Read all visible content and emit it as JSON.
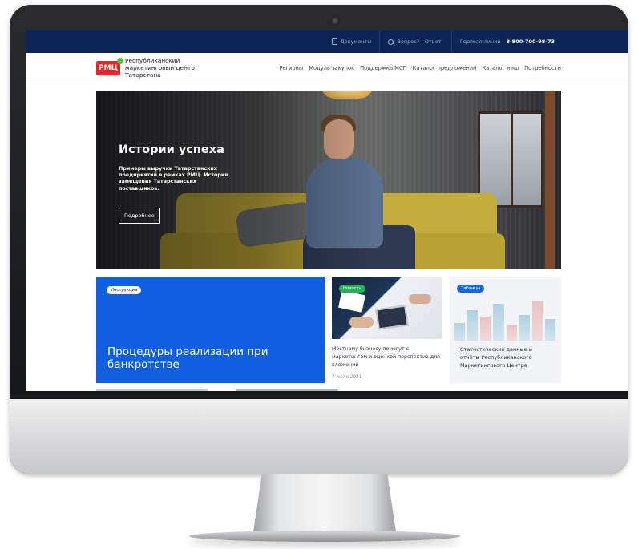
{
  "topbar": {
    "documents": "Документы",
    "qa": "Вопрос? - Ответ!",
    "hotline_label": "Горячая линия",
    "hotline_number": "8-800-700-98-73"
  },
  "header": {
    "logo_mark": "РМЦ",
    "logo_text": "Республиканский маркетинговый центр Татарстана"
  },
  "nav": {
    "items": [
      "Регионы",
      "Модуль закупок",
      "Поддержка МСП",
      "Каталог предложений",
      "Каталог ниш",
      "Потребности"
    ]
  },
  "hero": {
    "title": "Истории успеха",
    "description": "Примеры выручки Татарстанских предприятий в рамках РМЦ. История замещения Татарстанских поставщиков.",
    "button": "Подробнее"
  },
  "cards": {
    "instruction": {
      "badge": "Инструкция",
      "title": "Процедуры реализации при банкротстве"
    },
    "news": {
      "badge": "Новость",
      "title": "Местному бизнесу помогут с маркетингом и оценкой перспектив для вложений",
      "date": "7 июля 2021"
    },
    "tables": {
      "badge": "Таблицы",
      "title": "Статистические данные и отчёты Республиканского Маркетингового Центра"
    }
  },
  "colors": {
    "topbar_bg": "#0b2555",
    "brand_red": "#e4262d",
    "brand_green": "#62b947",
    "card_blue": "#0f5fe0",
    "badge_green": "#22b35a"
  },
  "icons": [
    "document-icon",
    "search-icon",
    "camera-icon"
  ]
}
